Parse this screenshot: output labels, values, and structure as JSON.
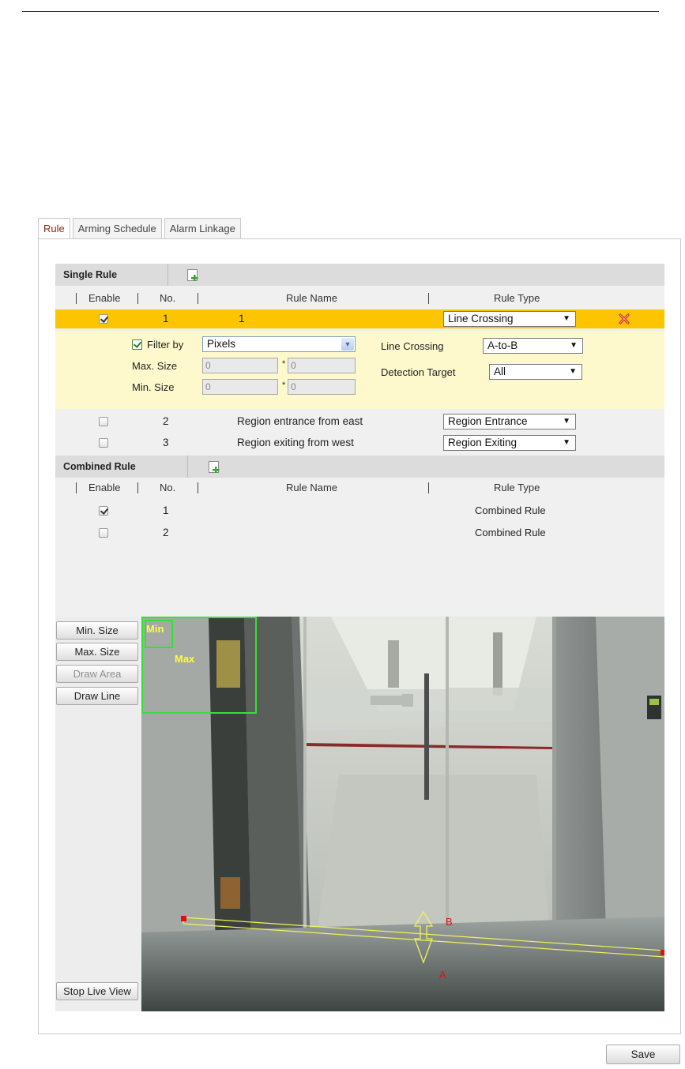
{
  "tabs": [
    "Rule",
    "Arming Schedule",
    "Alarm Linkage"
  ],
  "single_rule": {
    "title": "Single Rule",
    "columns": {
      "enable": "Enable",
      "no": "No.",
      "name": "Rule Name",
      "type": "Rule Type"
    },
    "rows": [
      {
        "enabled": true,
        "no": "1",
        "name": "1",
        "type": "Line Crossing"
      },
      {
        "enabled": false,
        "no": "2",
        "name": "Region entrance from east",
        "type": "Region Entrance"
      },
      {
        "enabled": false,
        "no": "3",
        "name": "Region exiting from west",
        "type": "Region Exiting"
      }
    ],
    "detail": {
      "filter_label": "Filter by",
      "filter_value": "Pixels",
      "max_label": "Max. Size",
      "min_label": "Min. Size",
      "max_w": "0",
      "max_h": "0",
      "min_w": "0",
      "min_h": "0",
      "times": "*",
      "line_crossing_label": "Line Crossing",
      "line_crossing_value": "A-to-B",
      "target_label": "Detection Target",
      "target_value": "All"
    }
  },
  "combined_rule": {
    "title": "Combined Rule",
    "columns": {
      "enable": "Enable",
      "no": "No.",
      "name": "Rule Name",
      "type": "Rule Type"
    },
    "rows": [
      {
        "enabled": true,
        "no": "1",
        "type": "Combined Rule"
      },
      {
        "enabled": false,
        "no": "2",
        "type": "Combined Rule"
      }
    ]
  },
  "side_buttons": {
    "min_size": "Min. Size",
    "max_size": "Max. Size",
    "draw_area": "Draw Area",
    "draw_line": "Draw Line",
    "stop_live": "Stop Live View"
  },
  "overlay": {
    "min": "Min",
    "max": "Max",
    "side_a": "A",
    "side_b": "B"
  },
  "save_label": "Save",
  "colors": {
    "highlight": "#fcc500",
    "detail_bg": "#fdf9cc",
    "overlay_box": "#35e035",
    "overlay_text": "#ffff33",
    "line": "#f2f25c",
    "endpoint": "#e01010"
  }
}
